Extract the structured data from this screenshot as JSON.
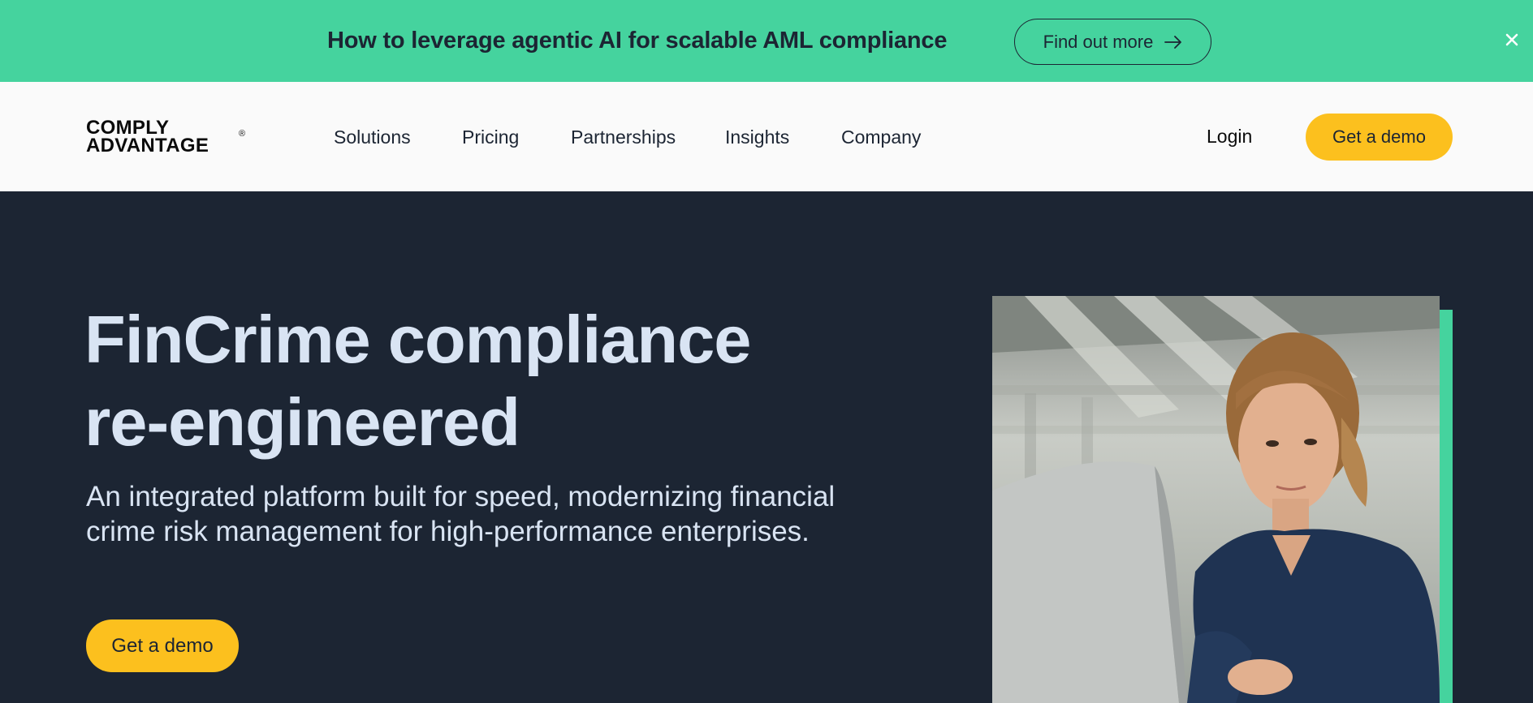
{
  "banner": {
    "text": "How to leverage agentic AI for scalable AML compliance",
    "cta_label": "Find out more",
    "close_icon": "close-icon",
    "background": "#45d39e"
  },
  "nav": {
    "logo_line1": "COMPLY",
    "logo_line2": "ADVANTAGE",
    "logo_mark": "®",
    "items": [
      "Solutions",
      "Pricing",
      "Partnerships",
      "Insights",
      "Company"
    ],
    "login_label": "Login",
    "demo_label": "Get a demo"
  },
  "hero": {
    "title_line1": "FinCrime compliance",
    "title_line2": "re-engineered",
    "subtitle_line1": "An integrated platform built for speed, modernizing financial",
    "subtitle_line2": "crime risk management for high-performance enterprises.",
    "demo_label": "Get a demo",
    "background": "#1c2533",
    "accent": "#fcc01e"
  }
}
